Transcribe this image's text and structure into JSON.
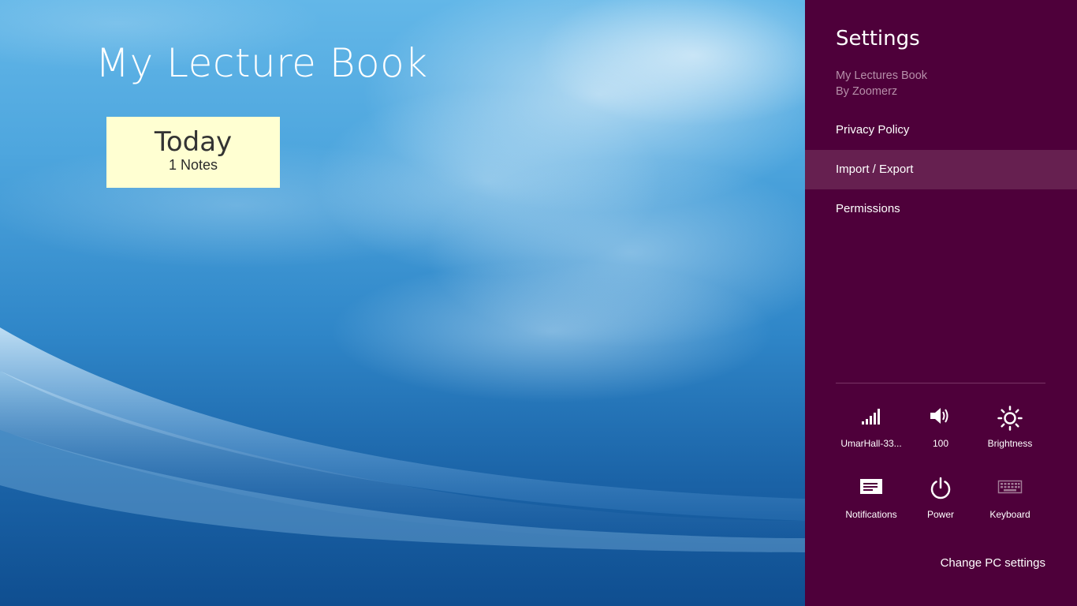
{
  "app": {
    "title": "My Lecture Book",
    "tile": {
      "title": "Today",
      "count": "1 Notes"
    }
  },
  "settings": {
    "title": "Settings",
    "app_name": "My Lectures Book",
    "publisher": "By Zoomerz",
    "items": [
      {
        "label": "Privacy Policy"
      },
      {
        "label": "Import / Export"
      },
      {
        "label": "Permissions"
      }
    ],
    "selected_item": "Import / Export",
    "system": {
      "network": {
        "label": "UmarHall-33...",
        "icon": "wifi-signal-icon"
      },
      "volume": {
        "label": "100",
        "icon": "volume-icon"
      },
      "brightness": {
        "label": "Brightness",
        "icon": "brightness-icon"
      },
      "notifications": {
        "label": "Notifications",
        "icon": "notifications-icon"
      },
      "power": {
        "label": "Power",
        "icon": "power-icon"
      },
      "keyboard": {
        "label": "Keyboard",
        "icon": "keyboard-icon"
      }
    },
    "change_pc_settings": "Change PC settings"
  },
  "colors": {
    "charm_bg": "#4e003a",
    "charm_selected": "#662050",
    "tile_bg": "#ffffd2",
    "sky_top": "#63b7e8",
    "sky_bottom": "#0f4e90"
  }
}
